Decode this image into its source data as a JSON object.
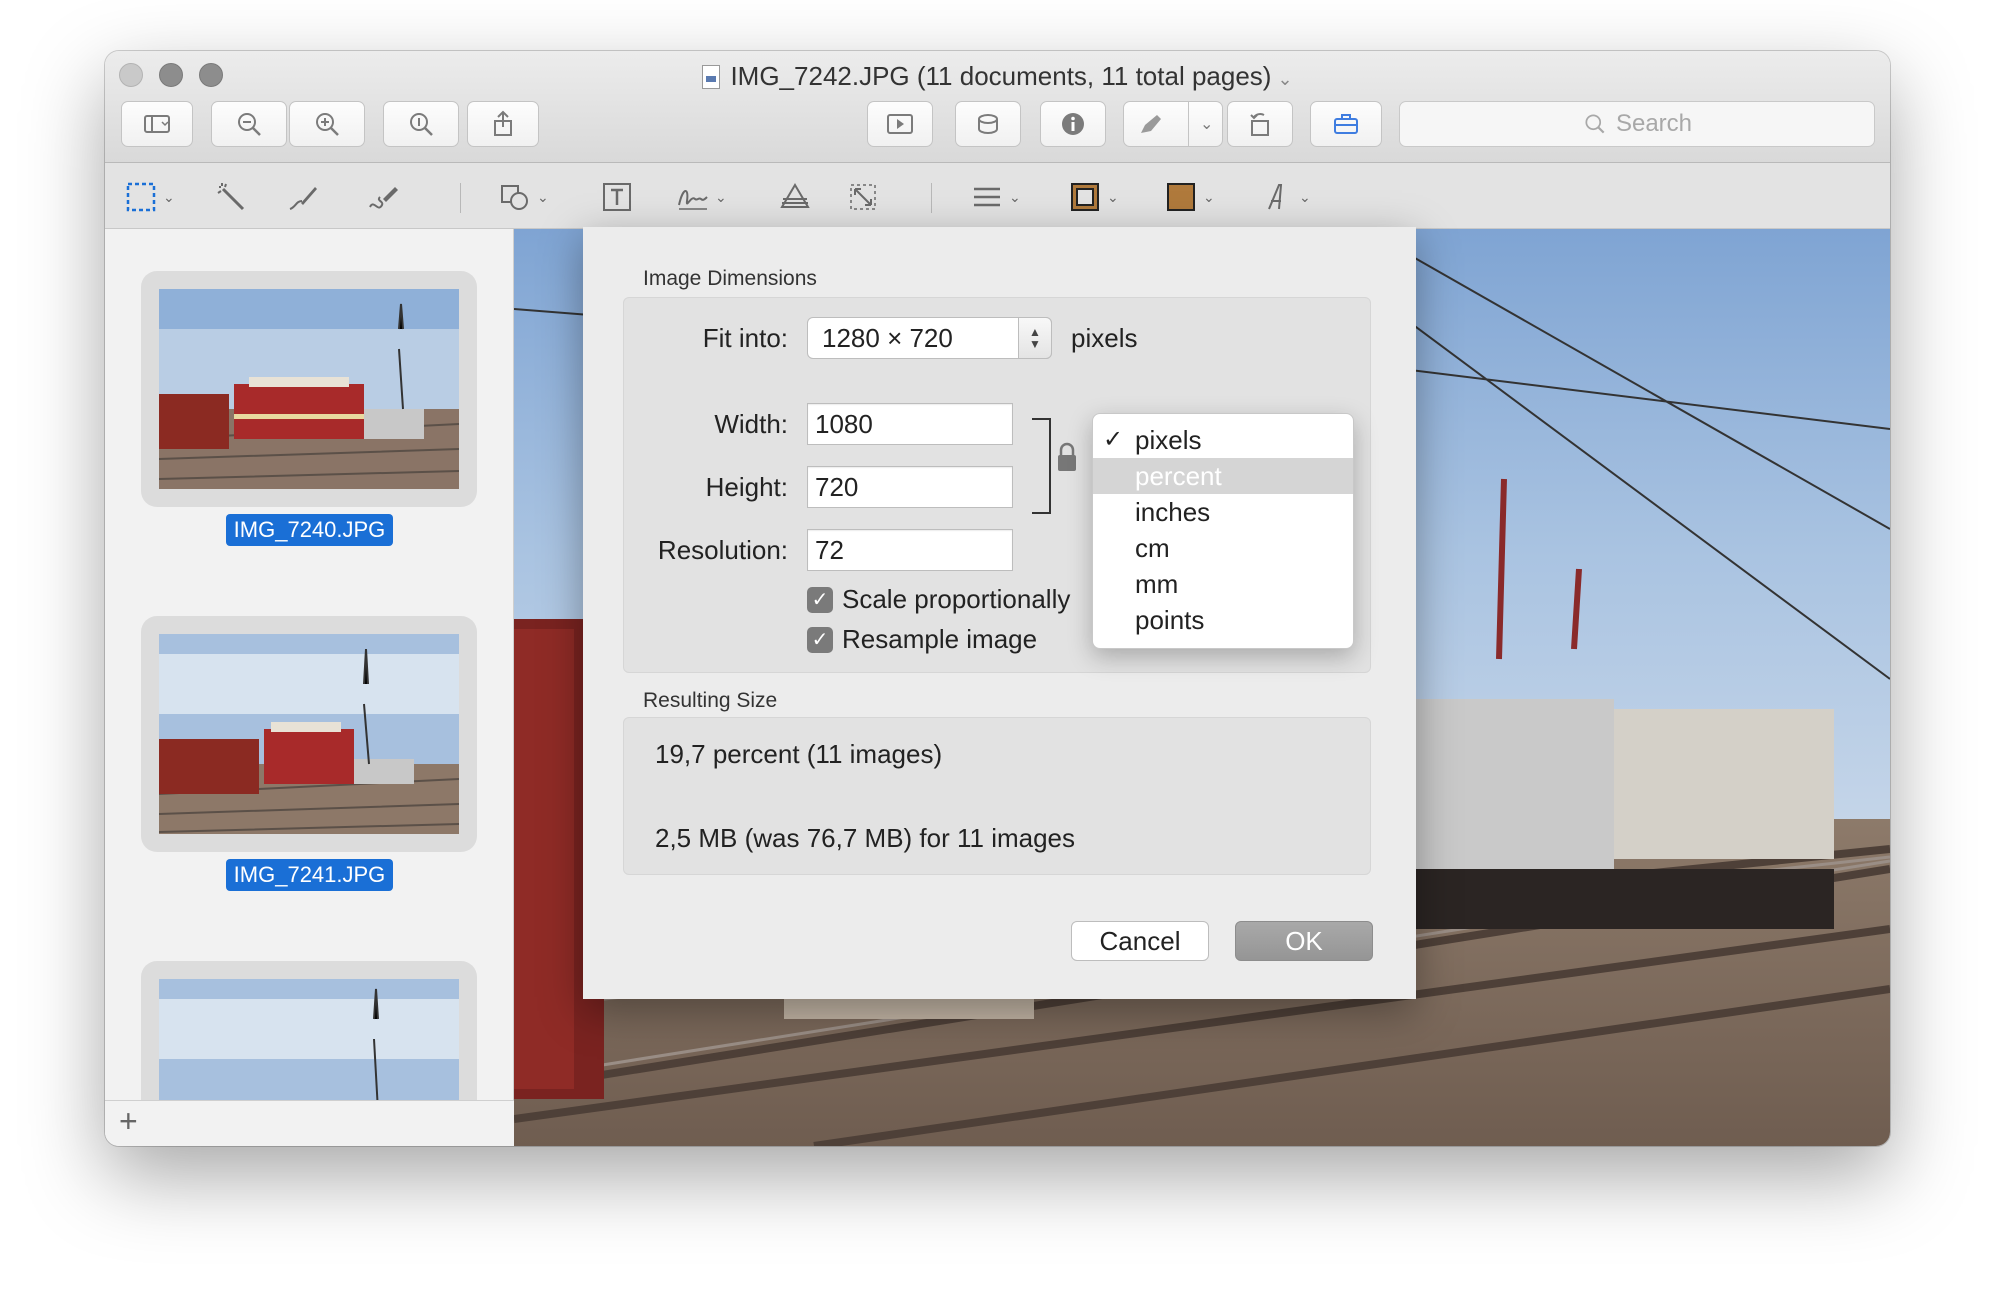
{
  "window": {
    "title": "IMG_7242.JPG (11 documents, 11 total pages)",
    "title_caret": "⌄"
  },
  "toolbar": {
    "search_placeholder": "Search"
  },
  "sidebar": {
    "thumbnails": [
      {
        "label": "IMG_7240.JPG"
      },
      {
        "label": "IMG_7241.JPG"
      },
      {
        "label": ""
      }
    ],
    "add_label": "+"
  },
  "dialog": {
    "image_dimensions_title": "Image Dimensions",
    "fit_into_label": "Fit into:",
    "fit_into_value": "1280 × 720",
    "fit_into_unit": "pixels",
    "width_label": "Width:",
    "width_value": "1080",
    "height_label": "Height:",
    "height_value": "720",
    "resolution_label": "Resolution:",
    "resolution_value": "72",
    "scale_label": "Scale proportionally",
    "resample_label": "Resample image",
    "unit_menu": {
      "selected": "pixels",
      "highlighted": "percent",
      "items": [
        "pixels",
        "percent",
        "inches",
        "cm",
        "mm",
        "points"
      ]
    },
    "resulting_size_title": "Resulting Size",
    "result_percent": "19,7 percent (11 images)",
    "result_size": "2,5 MB (was 76,7 MB) for 11 images",
    "cancel_label": "Cancel",
    "ok_label": "OK"
  },
  "colors": {
    "selection_blue": "#1a6fd6",
    "border_swatch": "#3a2a1a",
    "fill_swatch": "#b07a3c"
  }
}
